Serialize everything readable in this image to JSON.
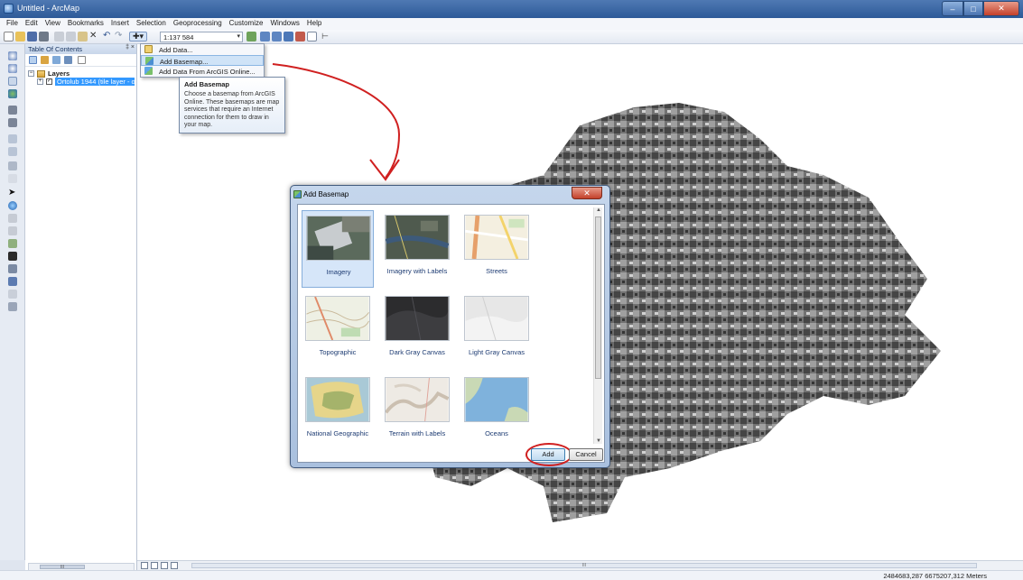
{
  "window": {
    "title": "Untitled - ArcMap"
  },
  "menu": [
    "File",
    "Edit",
    "View",
    "Bookmarks",
    "Insert",
    "Selection",
    "Geoprocessing",
    "Customize",
    "Windows",
    "Help"
  ],
  "toolbar": {
    "scale": "1:137 584"
  },
  "toc": {
    "title": "Table Of Contents",
    "pin": "‡ ×",
    "root": "Layers",
    "layer": "Ortolub 1944 (tile layer - or",
    "expander_root": "−",
    "expander_layer": "+",
    "checkbox": "✓",
    "scroll_grip": "III"
  },
  "add_data_menu": {
    "items": [
      "Add Data...",
      "Add Basemap...",
      "Add Data From ArcGIS Online..."
    ],
    "selected_index": 1
  },
  "tooltip": {
    "title": "Add Basemap",
    "text": "Choose a basemap from ArcGIS Online. These basemaps are map services that require an Internet connection for them to draw in your map."
  },
  "dialog": {
    "title": "Add Basemap",
    "close": "✕",
    "basemaps": [
      "Imagery",
      "Imagery with Labels",
      "Streets",
      "Topographic",
      "Dark Gray Canvas",
      "Light Gray Canvas",
      "National Geographic",
      "Terrain with Labels",
      "Oceans"
    ],
    "selected": "Imagery",
    "add_label": "Add",
    "cancel_label": "Cancel"
  },
  "map": {
    "scroll_grip": "III"
  },
  "status": {
    "coordinates": "2484683,287  6675207,312 Meters"
  },
  "colors": {
    "highlight": "#3399ff",
    "annotation": "#d02020",
    "titlebar": "#2d5a98"
  },
  "icons": [
    "app-icon",
    "zoom-in-icon",
    "zoom-out-icon",
    "pan-icon",
    "full-extent-icon",
    "identify-icon",
    "add-data-icon",
    "basemap-icon",
    "arcgis-online-icon"
  ]
}
